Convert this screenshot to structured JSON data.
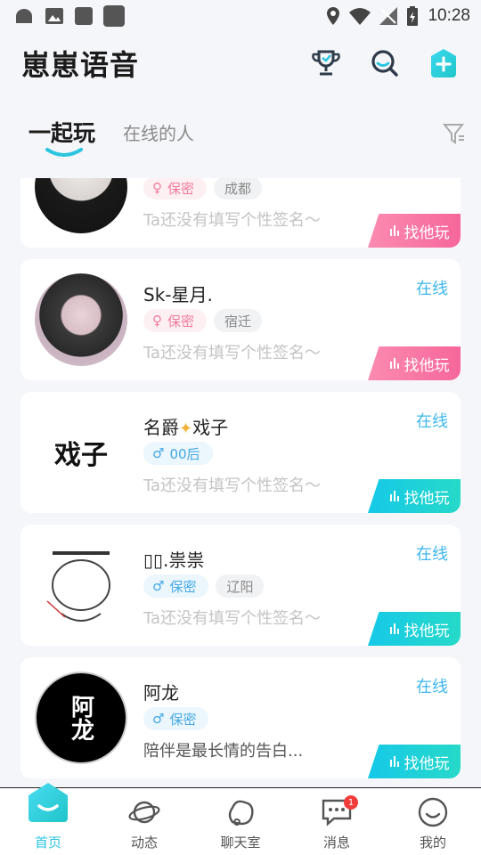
{
  "status_bar": {
    "time": "10:28"
  },
  "header": {
    "title": "崽崽语音"
  },
  "tabs": [
    {
      "label": "一起玩",
      "active": true
    },
    {
      "label": "在线的人",
      "active": false
    }
  ],
  "colors": {
    "accent": "#2bc5e0",
    "online": "#3eb7ef",
    "pink_btn": "#f6679a",
    "blue_btn": "#16c9e8"
  },
  "users": [
    {
      "name": "",
      "online": "",
      "gender": "female",
      "tag": "保密",
      "city": "成都",
      "signature": "Ta还没有填写个性签名～",
      "button": "找他玩",
      "button_color": "pink"
    },
    {
      "name": "Sk-星月.",
      "online": "在线",
      "gender": "female",
      "tag": "保密",
      "city": "宿迁",
      "signature": "Ta还没有填写个性签名～",
      "button": "找他玩",
      "button_color": "pink"
    },
    {
      "name": "名爵",
      "name_suffix": "戏子",
      "online": "在线",
      "gender": "male",
      "tag": "00后",
      "city": "",
      "signature": "Ta还没有填写个性签名～",
      "button": "找他玩",
      "button_color": "blue",
      "avatar_text": "戏子"
    },
    {
      "name": "▯▯.祟祟",
      "online": "在线",
      "gender": "male",
      "tag": "保密",
      "city": "辽阳",
      "signature": "Ta还没有填写个性签名～",
      "button": "找他玩",
      "button_color": "blue"
    },
    {
      "name": "阿龙",
      "online": "在线",
      "gender": "male",
      "tag": "保密",
      "city": "",
      "signature": "陪伴是最长情的告白...",
      "button": "找他玩",
      "button_color": "blue",
      "avatar_text": "阿龙"
    }
  ],
  "nav": [
    {
      "label": "首页",
      "icon": "home-icon",
      "active": true
    },
    {
      "label": "动态",
      "icon": "planet-icon",
      "active": false
    },
    {
      "label": "聊天室",
      "icon": "chatroom-icon",
      "active": false
    },
    {
      "label": "消息",
      "icon": "message-icon",
      "active": false,
      "badge": "1"
    },
    {
      "label": "我的",
      "icon": "smile-icon",
      "active": false
    }
  ]
}
